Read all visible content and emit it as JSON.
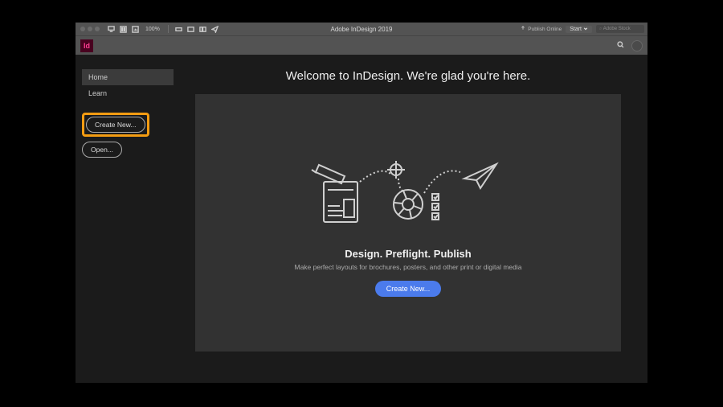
{
  "menubar": {
    "zoom": "100%",
    "title": "Adobe InDesign 2019",
    "publish_online": "Publish Online",
    "start": "Start",
    "search_placeholder": "Adobe Stock"
  },
  "logo_text": "Id",
  "sidebar": {
    "items": [
      {
        "label": "Home",
        "active": true
      },
      {
        "label": "Learn",
        "active": false
      }
    ],
    "create_new": "Create New...",
    "open": "Open..."
  },
  "main": {
    "welcome": "Welcome to InDesign. We're glad you're here.",
    "tagline": "Design. Preflight. Publish",
    "subtag": "Make perfect layouts for brochures, posters, and other print or digital media",
    "cta": "Create New..."
  }
}
